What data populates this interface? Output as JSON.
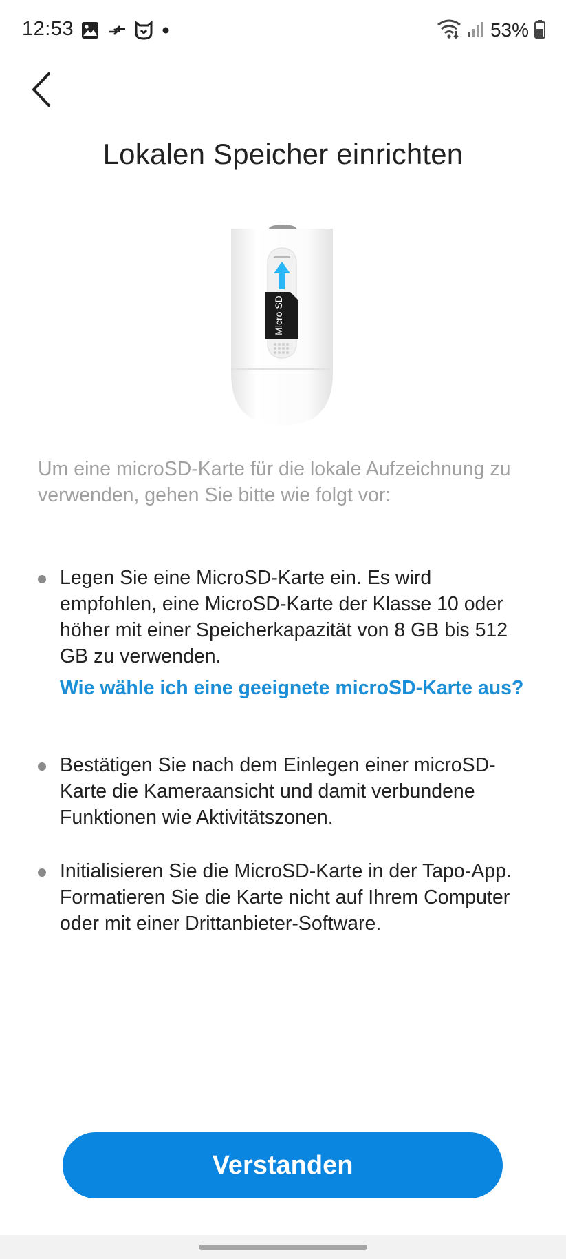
{
  "status_bar": {
    "time": "12:53",
    "left_icons": [
      "image-icon",
      "data-transfer-icon",
      "mi-home-icon",
      "dot-icon"
    ],
    "right_icons": [
      "wifi-icon",
      "signal-icon",
      "battery-icon"
    ],
    "battery_percent": "53%"
  },
  "header": {
    "back_icon": "chevron-left-icon",
    "title": "Lokalen Speicher einrichten"
  },
  "illustration": {
    "card_label": "Micro SD",
    "arrow_color": "#29b6f6"
  },
  "intro": "Um eine microSD-Karte für die lokale Aufzeichnung zu verwenden, gehen Sie bitte wie folgt vor:",
  "steps": [
    {
      "text": "Legen Sie eine MicroSD-Karte ein. Es wird empfohlen, eine MicroSD-Karte der Klasse 10 oder höher mit einer Speicherkapazität von 8 GB bis 512 GB zu verwenden.",
      "link": "Wie wähle ich eine geeignete microSD-Karte aus?"
    },
    {
      "text": "Bestätigen Sie nach dem Einlegen einer microSD-Karte die Kameraansicht und damit verbundene Funktionen wie Aktivitätszonen."
    },
    {
      "text": "Initialisieren Sie die MicroSD-Karte in der Tapo-App. Formatieren Sie die Karte nicht auf Ihrem Computer oder mit einer Drittanbieter-Software."
    }
  ],
  "primary_button": {
    "label": "Verstanden"
  },
  "colors": {
    "accent": "#0a85e0",
    "link": "#1a8fd8",
    "muted_text": "#a0a0a0"
  }
}
